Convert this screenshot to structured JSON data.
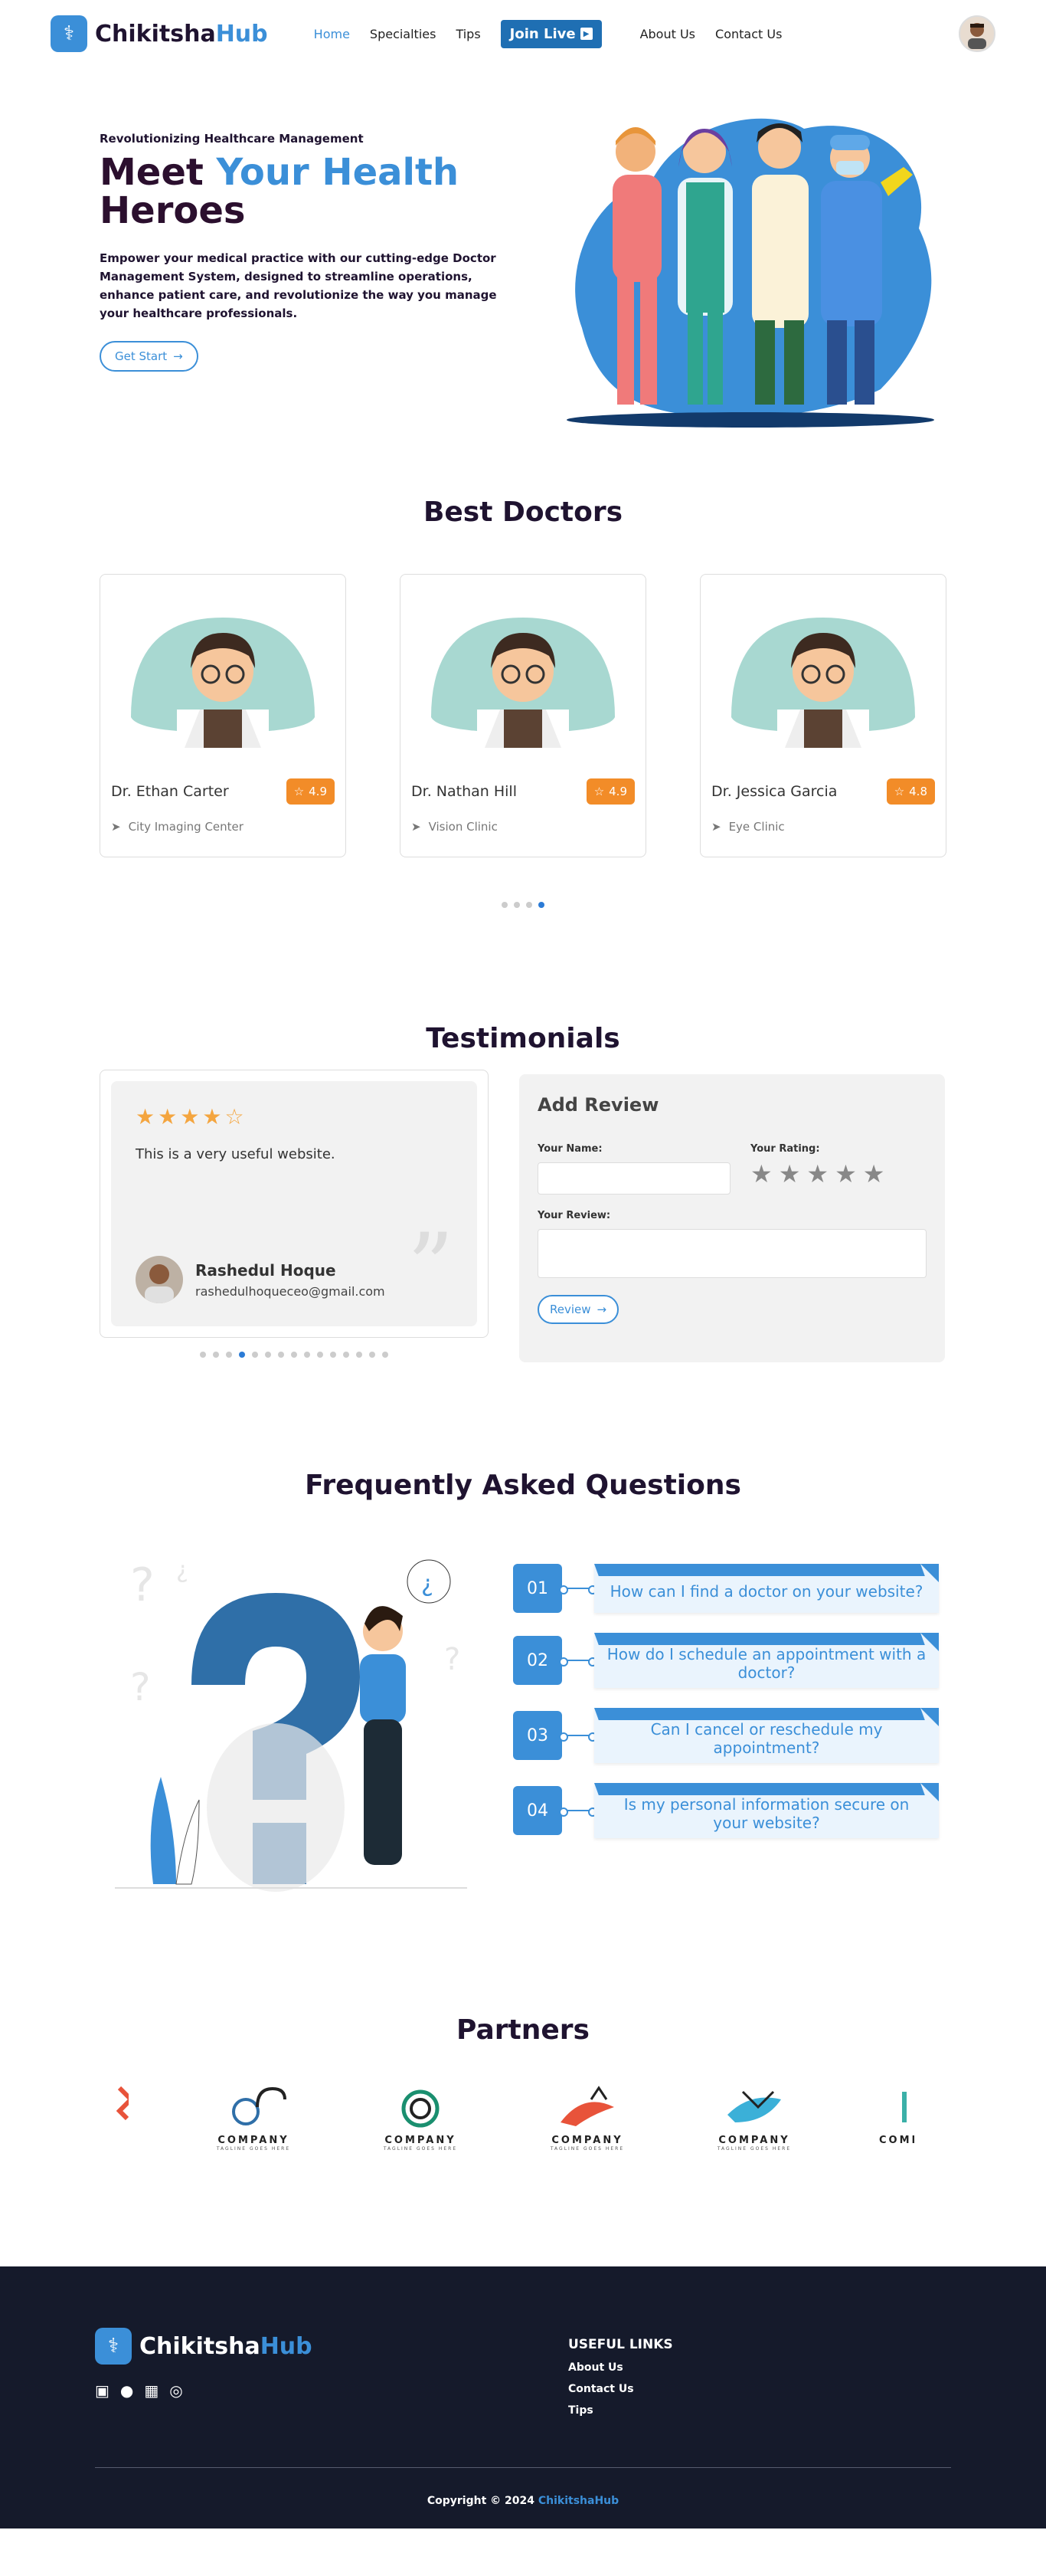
{
  "brand": {
    "name_main": "Chikitsha",
    "name_accent": "Hub"
  },
  "nav": {
    "home": "Home",
    "specialties": "Specialties",
    "tips": "Tips",
    "join_live": "Join Live",
    "about": "About Us",
    "contact": "Contact Us"
  },
  "hero": {
    "kicker": "Revolutionizing Healthcare Management",
    "title_a": "Meet ",
    "title_b": "Your Health",
    "title_c": "Heroes",
    "description": "Empower your medical practice with our cutting-edge Doctor Management System, designed to streamline operations, enhance patient care, and revolutionize the way you manage your healthcare professionals.",
    "cta": "Get Start"
  },
  "doctors": {
    "title": "Best Doctors",
    "items": [
      {
        "name": "Dr. Ethan Carter",
        "rating": "4.9",
        "clinic": "City Imaging Center"
      },
      {
        "name": "Dr. Nathan Hill",
        "rating": "4.9",
        "clinic": "Vision Clinic"
      },
      {
        "name": "Dr. Jessica Garcia",
        "rating": "4.8",
        "clinic": "Eye Clinic"
      }
    ]
  },
  "testimonials": {
    "title": "Testimonials",
    "stars": 4,
    "text": "This is a very useful website.",
    "author": "Rashedul Hoque",
    "email": "rashedulhoqueceo@gmail.com"
  },
  "review": {
    "title": "Add Review",
    "name_label": "Your Name:",
    "rating_label": "Your Rating:",
    "review_label": "Your Review:",
    "button": "Review"
  },
  "faq": {
    "title": "Frequently Asked Questions",
    "items": [
      {
        "num": "01",
        "q": "How can I find a doctor on your website?"
      },
      {
        "num": "02",
        "q": "How do I schedule an appointment with a doctor?"
      },
      {
        "num": "03",
        "q": "Can I cancel or reschedule my appointment?"
      },
      {
        "num": "04",
        "q": "Is my personal information secure on your website?"
      }
    ]
  },
  "partners": {
    "title": "Partners",
    "label": "COMPANY",
    "tagline": "TAGLINE GOES HERE"
  },
  "footer": {
    "links_title": "USEFUL LINKS",
    "links": [
      "About Us",
      "Contact Us",
      "Tips"
    ],
    "copyright_prefix": "Copyright © 2024 ",
    "copyright_brand": "ChikitshaHub"
  },
  "colors": {
    "accent": "#3b8fd8",
    "orange": "#f28c28",
    "dark": "#151a2b"
  }
}
